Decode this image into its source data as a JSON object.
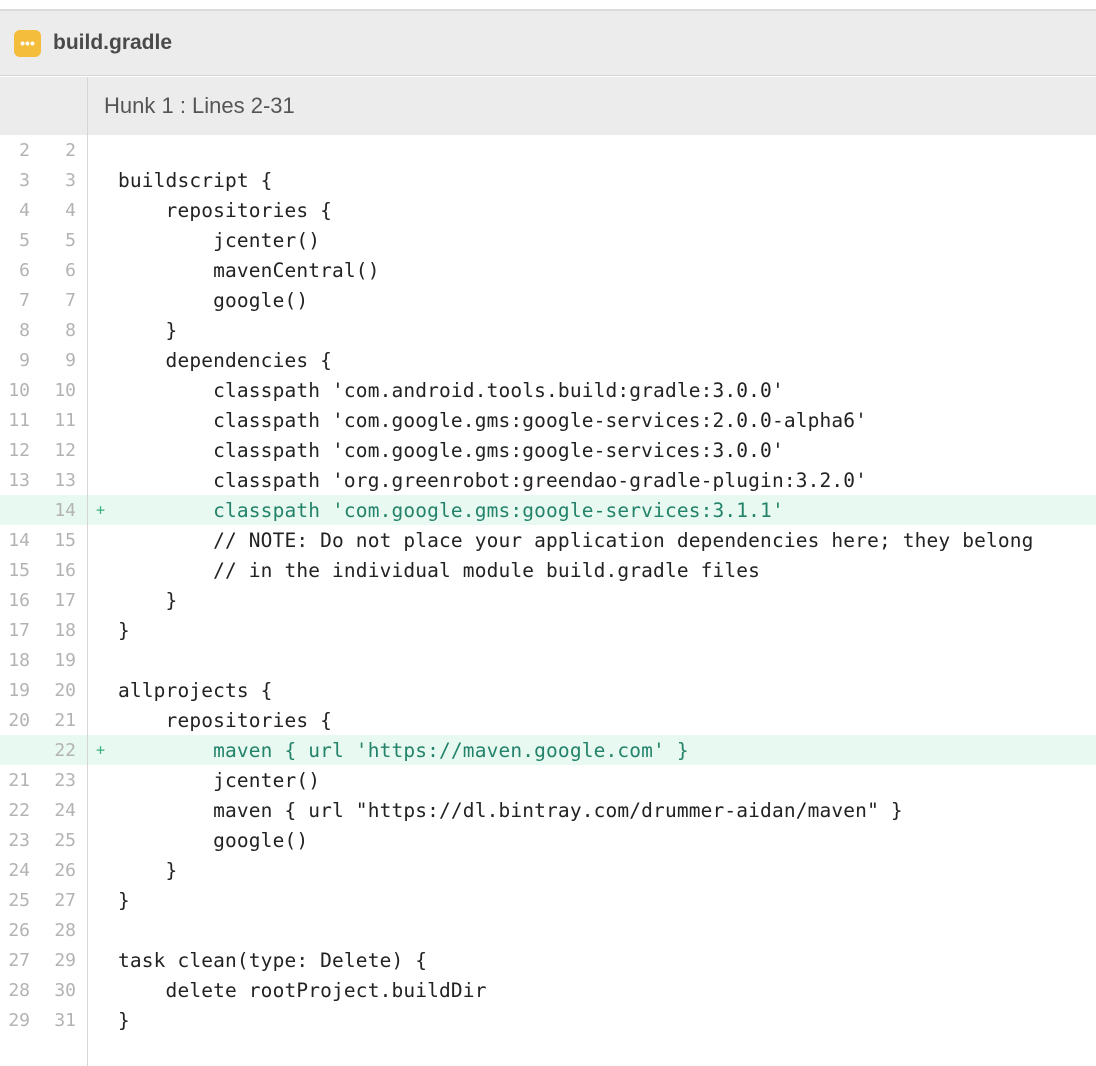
{
  "file": {
    "name": "build.gradle",
    "icon": "more-dots-icon",
    "icon_glyph": "•••",
    "icon_color": "#f5bd3c"
  },
  "hunk": {
    "label": "Hunk 1 : Lines 2-31"
  },
  "colors": {
    "added_bg": "#e8f9f1",
    "added_text": "#23836a",
    "line_number": "#b3b3b3",
    "header_bg": "#ececec"
  },
  "lines": [
    {
      "old": "2",
      "new": "2",
      "mark": "",
      "added": false,
      "text": ""
    },
    {
      "old": "3",
      "new": "3",
      "mark": "",
      "added": false,
      "text": "buildscript {"
    },
    {
      "old": "4",
      "new": "4",
      "mark": "",
      "added": false,
      "text": "    repositories {"
    },
    {
      "old": "5",
      "new": "5",
      "mark": "",
      "added": false,
      "text": "        jcenter()"
    },
    {
      "old": "6",
      "new": "6",
      "mark": "",
      "added": false,
      "text": "        mavenCentral()"
    },
    {
      "old": "7",
      "new": "7",
      "mark": "",
      "added": false,
      "text": "        google()"
    },
    {
      "old": "8",
      "new": "8",
      "mark": "",
      "added": false,
      "text": "    }"
    },
    {
      "old": "9",
      "new": "9",
      "mark": "",
      "added": false,
      "text": "    dependencies {"
    },
    {
      "old": "10",
      "new": "10",
      "mark": "",
      "added": false,
      "text": "        classpath 'com.android.tools.build:gradle:3.0.0'"
    },
    {
      "old": "11",
      "new": "11",
      "mark": "",
      "added": false,
      "text": "        classpath 'com.google.gms:google-services:2.0.0-alpha6'"
    },
    {
      "old": "12",
      "new": "12",
      "mark": "",
      "added": false,
      "text": "        classpath 'com.google.gms:google-services:3.0.0'"
    },
    {
      "old": "13",
      "new": "13",
      "mark": "",
      "added": false,
      "text": "        classpath 'org.greenrobot:greendao-gradle-plugin:3.2.0'"
    },
    {
      "old": "",
      "new": "14",
      "mark": "+",
      "added": true,
      "text": "        classpath 'com.google.gms:google-services:3.1.1'"
    },
    {
      "old": "14",
      "new": "15",
      "mark": "",
      "added": false,
      "text": "        // NOTE: Do not place your application dependencies here; they belong"
    },
    {
      "old": "15",
      "new": "16",
      "mark": "",
      "added": false,
      "text": "        // in the individual module build.gradle files"
    },
    {
      "old": "16",
      "new": "17",
      "mark": "",
      "added": false,
      "text": "    }"
    },
    {
      "old": "17",
      "new": "18",
      "mark": "",
      "added": false,
      "text": "}"
    },
    {
      "old": "18",
      "new": "19",
      "mark": "",
      "added": false,
      "text": ""
    },
    {
      "old": "19",
      "new": "20",
      "mark": "",
      "added": false,
      "text": "allprojects {"
    },
    {
      "old": "20",
      "new": "21",
      "mark": "",
      "added": false,
      "text": "    repositories {"
    },
    {
      "old": "",
      "new": "22",
      "mark": "+",
      "added": true,
      "text": "        maven { url 'https://maven.google.com' }"
    },
    {
      "old": "21",
      "new": "23",
      "mark": "",
      "added": false,
      "text": "        jcenter()"
    },
    {
      "old": "22",
      "new": "24",
      "mark": "",
      "added": false,
      "text": "        maven { url \"https://dl.bintray.com/drummer-aidan/maven\" }"
    },
    {
      "old": "23",
      "new": "25",
      "mark": "",
      "added": false,
      "text": "        google()"
    },
    {
      "old": "24",
      "new": "26",
      "mark": "",
      "added": false,
      "text": "    }"
    },
    {
      "old": "25",
      "new": "27",
      "mark": "",
      "added": false,
      "text": "}"
    },
    {
      "old": "26",
      "new": "28",
      "mark": "",
      "added": false,
      "text": ""
    },
    {
      "old": "27",
      "new": "29",
      "mark": "",
      "added": false,
      "text": "task clean(type: Delete) {"
    },
    {
      "old": "28",
      "new": "30",
      "mark": "",
      "added": false,
      "text": "    delete rootProject.buildDir"
    },
    {
      "old": "29",
      "new": "31",
      "mark": "",
      "added": false,
      "text": "}"
    }
  ]
}
